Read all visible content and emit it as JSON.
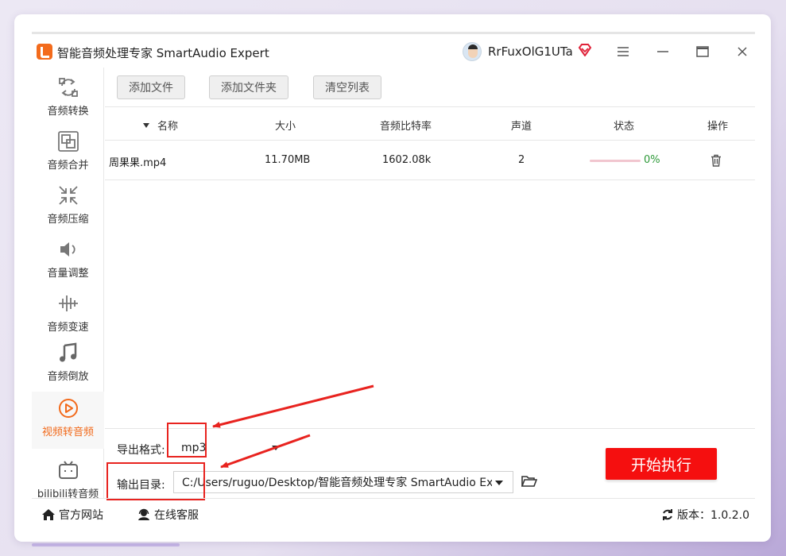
{
  "window": {
    "title": "智能音频处理专家 SmartAudio Expert",
    "user_name": "RrFuxOlG1UTa",
    "menu_icon": "hamburger-icon",
    "minimize_icon": "minimize-icon",
    "maximize_icon": "maximize-icon",
    "close_icon": "close-icon"
  },
  "sidebar": {
    "items": [
      {
        "label": "音频转换",
        "icon": "audio-convert-icon"
      },
      {
        "label": "音频合并",
        "icon": "audio-merge-icon"
      },
      {
        "label": "音频压缩",
        "icon": "audio-compress-icon"
      },
      {
        "label": "音量调整",
        "icon": "volume-icon"
      },
      {
        "label": "音频变速",
        "icon": "audio-speed-icon"
      },
      {
        "label": "音频倒放",
        "icon": "music-note-icon"
      },
      {
        "label": "视频转音频",
        "icon": "play-circle-icon",
        "active": true
      },
      {
        "label": "bilibili转音频",
        "icon": "tv-icon"
      }
    ]
  },
  "toolbar": {
    "add_file": "添加文件",
    "add_folder": "添加文件夹",
    "clear_list": "清空列表"
  },
  "table": {
    "columns": {
      "name": "名称",
      "size": "大小",
      "bitrate": "音频比特率",
      "channels": "声道",
      "status": "状态",
      "action": "操作"
    },
    "rows": [
      {
        "name": "周果果.mp4",
        "size": "11.70MB",
        "bitrate": "1602.08k",
        "channels": "2",
        "progress": "0%"
      }
    ]
  },
  "output": {
    "format_label": "导出格式:",
    "format_value": "mp3",
    "dir_label": "输出目录:",
    "dir_value": "C:/Users/ruguo/Desktop/智能音频处理专家 SmartAudio Expert"
  },
  "actions": {
    "start": "开始执行"
  },
  "statusbar": {
    "website": "官方网站",
    "support": "在线客服",
    "version": "版本：1.0.2.0"
  },
  "colors": {
    "accent": "#f26a1b",
    "start_button": "#f50f0f",
    "annotation": "#e8231f",
    "progress_text": "#2f9a3a"
  }
}
